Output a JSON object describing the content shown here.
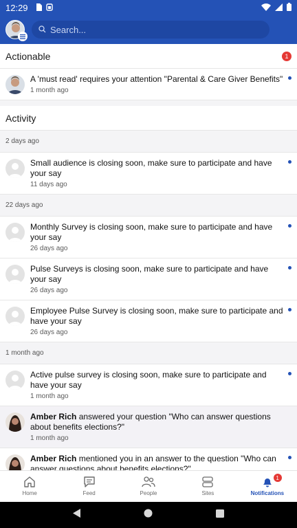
{
  "status_bar": {
    "time": "12:29"
  },
  "search": {
    "placeholder": "Search..."
  },
  "actionable": {
    "heading": "Actionable",
    "count": "1",
    "items": [
      {
        "title": "A 'must read' requires your attention \"Parental & Care Giver Benefits\"",
        "time": "1 month ago"
      }
    ]
  },
  "activity": {
    "heading": "Activity",
    "groups": [
      {
        "label": "2 days ago"
      },
      {
        "label": "22 days ago"
      },
      {
        "label": "1 month ago"
      }
    ],
    "items": [
      {
        "title": "Small audience is closing soon, make sure to participate and have your say",
        "time": "11 days ago"
      },
      {
        "title": "Monthly Survey is closing soon, make sure to participate and have your say",
        "time": "26 days ago"
      },
      {
        "title": "Pulse Surveys is closing soon, make sure to participate and have your say",
        "time": "26 days ago"
      },
      {
        "title": "Employee Pulse Survey is closing soon, make sure to participate and have your say",
        "time": "26 days ago"
      },
      {
        "title": "Active pulse survey is closing soon, make sure to participate and have your say",
        "time": "1 month ago"
      },
      {
        "name": "Amber Rich",
        "title": " answered your question \"Who can answer questions about benefits elections?\"",
        "time": "1 month ago"
      },
      {
        "name": "Amber Rich",
        "title": " mentioned you in an answer to the question \"Who can answer questions about benefits elections?\"",
        "time": ""
      }
    ]
  },
  "bottom_nav": {
    "items": [
      {
        "label": "Home",
        "icon": "home-icon"
      },
      {
        "label": "Feed",
        "icon": "chat-icon"
      },
      {
        "label": "People",
        "icon": "people-icon"
      },
      {
        "label": "Sites",
        "icon": "sites-icon"
      },
      {
        "label": "Notifications",
        "icon": "bell-icon",
        "badge": "1"
      }
    ]
  },
  "colors": {
    "brand": "#2452b6",
    "badge": "#e53935",
    "unread_dot": "#2452b6"
  }
}
